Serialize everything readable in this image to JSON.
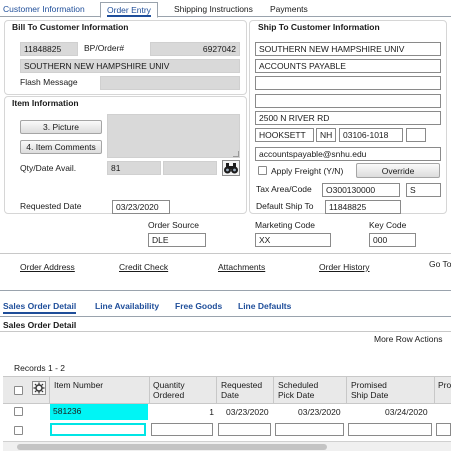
{
  "top_tabs": [
    "Customer Information",
    "Order Entry",
    "Shipping Instructions",
    "Payments"
  ],
  "bill_to": {
    "title": "Bill To Customer Information",
    "account": "11848825",
    "bp_label": "BP/Order#",
    "bp_value": "6927042",
    "name": "SOUTHERN NEW HAMPSHIRE UNIV",
    "flash_label": "Flash Message",
    "flash_value": ""
  },
  "item_info": {
    "title": "Item Information",
    "picture_button": "3. Picture",
    "comments_button": "4. Item Comments",
    "qty_label": "Qty/Date Avail.",
    "qty_value": "81",
    "qty_date": "",
    "requested_label": "Requested Date",
    "requested_value": "03/23/2020"
  },
  "ship_to": {
    "title": "Ship To Customer Information",
    "line1": "SOUTHERN NEW HAMPSHIRE UNIV",
    "line2": "ACCOUNTS PAYABLE",
    "line3": "",
    "line4": "",
    "street": "2500 N RIVER RD",
    "city": "HOOKSETT",
    "state": "NH",
    "zip": "03106-1018",
    "zip_ext": "",
    "email": "accountspayable@snhu.edu",
    "apply_freight_label": "Apply Freight (Y/N)",
    "override_button": "Override",
    "tax_label": "Tax Area/Code",
    "tax_value": "O300130000",
    "tax_code": "S",
    "default_ship_label": "Default Ship To",
    "default_ship_value": "11848825"
  },
  "order_fields": {
    "source_label": "Order Source",
    "source_value": "DLE",
    "marketing_label": "Marketing Code",
    "marketing_value": "XX",
    "key_label": "Key Code",
    "key_value": "000"
  },
  "links": [
    "Order Address",
    "Credit Check",
    "Attachments",
    "Order History",
    "Go To"
  ],
  "detail_tabs": [
    "Sales Order Detail",
    "Line Availability",
    "Free Goods",
    "Line Defaults"
  ],
  "detail": {
    "section_title": "Sales Order Detail",
    "more_actions": "More Row Actions",
    "records": "Records 1 - 2",
    "columns": [
      "Item Number",
      "Quantity Ordered",
      "Requested Date",
      "Scheduled Pick Date",
      "Promised Ship Date",
      "Pro"
    ],
    "rows": [
      {
        "item": "581236",
        "qty": "1",
        "requested": "03/23/2020",
        "pick": "03/23/2020",
        "ship": "03/24/2020"
      }
    ]
  },
  "colors": {
    "accent": "#1f4e9a",
    "highlight": "#00f5f5",
    "readonly": "#d9d9d9"
  },
  "icons": [
    "binoculars-icon",
    "settings-grid-icon"
  ]
}
